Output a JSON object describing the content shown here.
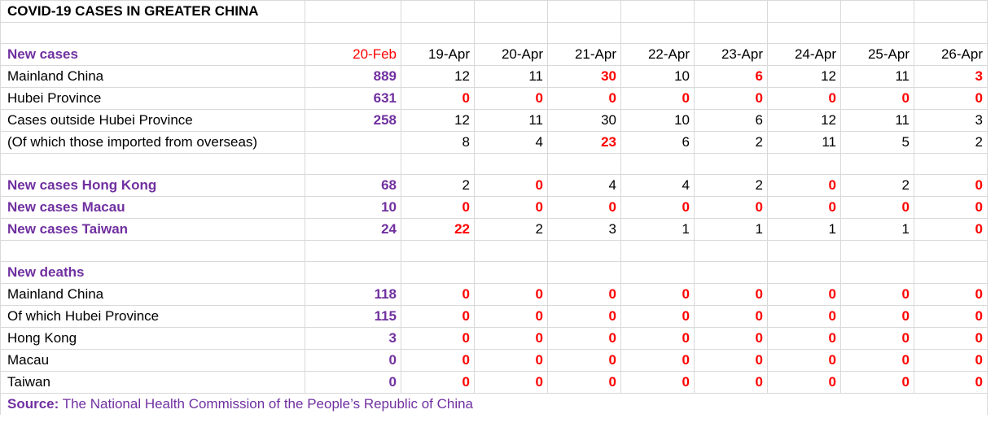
{
  "title": "COVID-19 CASES IN GREATER CHINA",
  "dates": [
    "20-Feb",
    "19-Apr",
    "20-Apr",
    "21-Apr",
    "22-Apr",
    "23-Apr",
    "24-Apr",
    "25-Apr",
    "26-Apr"
  ],
  "rows": [
    {
      "label": "New cases"
    },
    {
      "label": "Mainland China",
      "values": [
        "889",
        "12",
        "11",
        "30",
        "10",
        "6",
        "12",
        "11",
        "3"
      ]
    },
    {
      "label": "Hubei Province",
      "values": [
        "631",
        "0",
        "0",
        "0",
        "0",
        "0",
        "0",
        "0",
        "0"
      ]
    },
    {
      "label": "Cases outside Hubei Province",
      "values": [
        "258",
        "12",
        "11",
        "30",
        "10",
        "6",
        "12",
        "11",
        "3"
      ]
    },
    {
      "label": "(Of which those imported from overseas)",
      "values": [
        "",
        "8",
        "4",
        "23",
        "6",
        "2",
        "11",
        "5",
        "2"
      ]
    },
    {
      "label": "New cases Hong Kong",
      "values": [
        "68",
        "2",
        "0",
        "4",
        "4",
        "2",
        "0",
        "2",
        "0"
      ]
    },
    {
      "label": "New cases Macau",
      "values": [
        "10",
        "0",
        "0",
        "0",
        "0",
        "0",
        "0",
        "0",
        "0"
      ]
    },
    {
      "label": "New cases Taiwan",
      "values": [
        "24",
        "22",
        "2",
        "3",
        "1",
        "1",
        "1",
        "1",
        "0"
      ]
    },
    {
      "label": "New deaths"
    },
    {
      "label": "Mainland China",
      "values": [
        "118",
        "0",
        "0",
        "0",
        "0",
        "0",
        "0",
        "0",
        "0"
      ]
    },
    {
      "label": "Of which Hubei Province",
      "values": [
        "115",
        "0",
        "0",
        "0",
        "0",
        "0",
        "0",
        "0",
        "0"
      ]
    },
    {
      "label": "Hong Kong",
      "values": [
        "3",
        "0",
        "0",
        "0",
        "0",
        "0",
        "0",
        "0",
        "0"
      ]
    },
    {
      "label": "Macau",
      "values": [
        "0",
        "0",
        "0",
        "0",
        "0",
        "0",
        "0",
        "0",
        "0"
      ]
    },
    {
      "label": "Taiwan",
      "values": [
        "0",
        "0",
        "0",
        "0",
        "0",
        "0",
        "0",
        "0",
        "0"
      ]
    }
  ],
  "source": {
    "label": "Source:",
    "text": "The National Health Commission of the People’s Republic of China"
  },
  "colors": {
    "purple": "#7030a0",
    "red": "#ff0000",
    "gridline": "#d9d9d9"
  }
}
